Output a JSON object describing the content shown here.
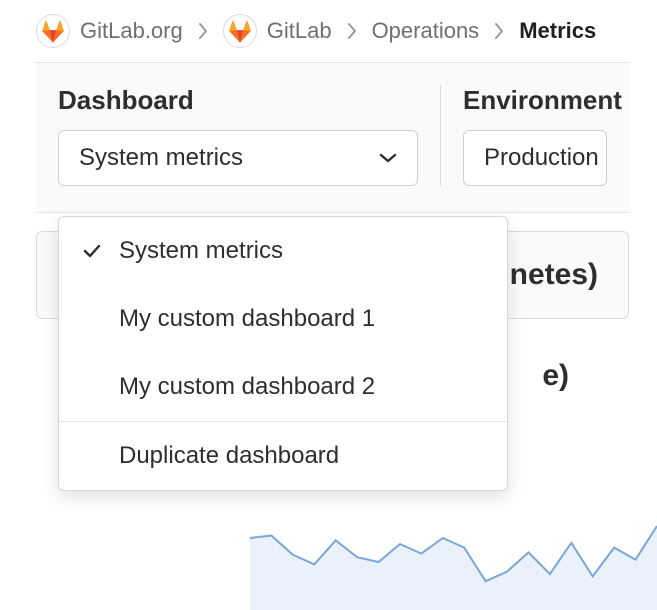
{
  "breadcrumb": {
    "group": "GitLab.org",
    "project": "GitLab",
    "section": "Operations",
    "page": "Metrics"
  },
  "filters": {
    "dashboard_label": "Dashboard",
    "environment_label": "Environment",
    "dashboard_selected": "System metrics",
    "environment_selected": "Production"
  },
  "dropdown": {
    "items": [
      {
        "label": "System metrics",
        "selected": true
      },
      {
        "label": "My custom dashboard 1",
        "selected": false
      },
      {
        "label": "My custom dashboard 2",
        "selected": false
      }
    ],
    "action_label": "Duplicate dashboard"
  },
  "panel": {
    "header_fragment": "netes)",
    "subtitle_fragment": "e)"
  },
  "chart_data": {
    "type": "line",
    "x": [
      0,
      1,
      2,
      3,
      4,
      5,
      6,
      7,
      8,
      9,
      10,
      11,
      12,
      13,
      14,
      15,
      16,
      17,
      18,
      19
    ],
    "values": [
      60,
      62,
      46,
      38,
      58,
      44,
      40,
      55,
      47,
      60,
      52,
      24,
      32,
      48,
      30,
      56,
      28,
      52,
      42,
      70
    ],
    "ylim": [
      0,
      100
    ],
    "stroke": "#7aa7d9",
    "fill": "#eaf1fa"
  }
}
